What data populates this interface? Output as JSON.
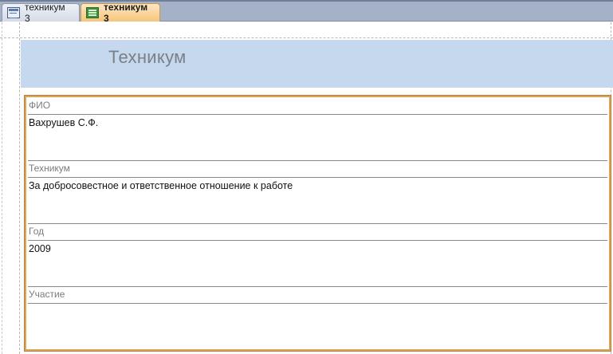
{
  "tabs": [
    {
      "label": "техникум 3",
      "icon": "form-icon",
      "active": false
    },
    {
      "label": "техникум 3",
      "icon": "report-icon",
      "active": true
    }
  ],
  "header": {
    "title": "Техникум"
  },
  "fields": [
    {
      "label": "ФИО",
      "value": "Вахрушев С.Ф."
    },
    {
      "label": "Техникум",
      "value": "За добросовестное и ответственное отношение к работе"
    },
    {
      "label": "Год",
      "value": "2009"
    },
    {
      "label": "Участие",
      "value": ""
    }
  ],
  "colors": {
    "header_band": "#c6d8ee",
    "frame_border": "#dca456",
    "active_tab": "#f7c57a"
  }
}
